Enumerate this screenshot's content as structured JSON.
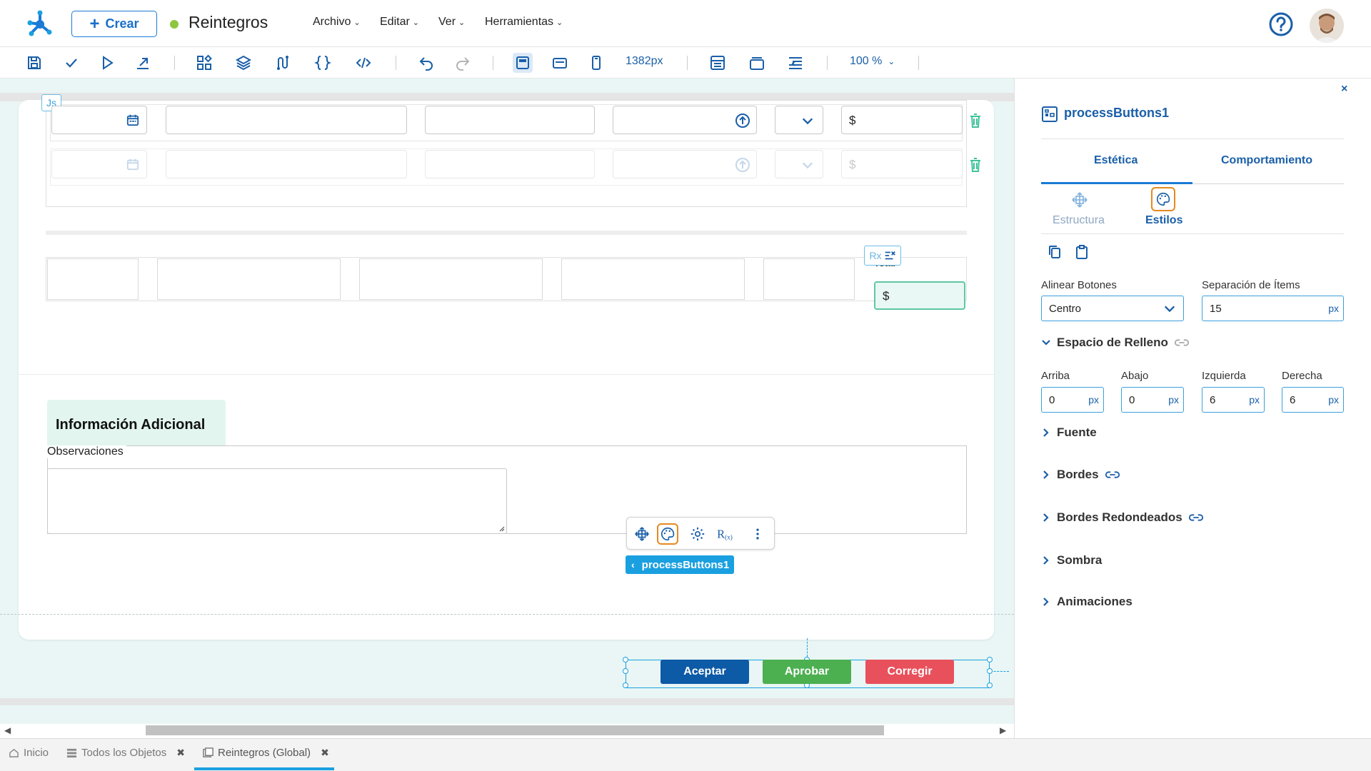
{
  "header": {
    "create_label": "Crear",
    "doc_title": "Reintegros",
    "menus": [
      "Archivo",
      "Editar",
      "Ver",
      "Herramientas"
    ]
  },
  "toolbar": {
    "width_label": "1382px",
    "zoom_label": "100 %"
  },
  "canvas": {
    "js_badge": "Js",
    "currency_symbol": "$",
    "total_label": "Total",
    "rx_badge": "Rx",
    "info_title": "Información Adicional",
    "obs_label": "Observaciones",
    "process_tag": "processButtons1",
    "buttons": {
      "accept": "Aceptar",
      "approve": "Aprobar",
      "correct": "Corregir"
    },
    "colors": {
      "accept": "#0d5aa6",
      "approve": "#4caf50",
      "correct": "#e8505b"
    }
  },
  "panel": {
    "close": "×",
    "title": "processButtons1",
    "tabs": [
      "Estética",
      "Comportamiento"
    ],
    "subtabs": [
      "Estructura",
      "Estilos"
    ],
    "align_label": "Alinear Botones",
    "align_value": "Centro",
    "sep_label": "Separación de Ítems",
    "sep_value": "15",
    "unit": "px",
    "padding_section": "Espacio de Relleno",
    "padding": [
      {
        "label": "Arriba",
        "value": "0"
      },
      {
        "label": "Abajo",
        "value": "0"
      },
      {
        "label": "Izquierda",
        "value": "6"
      },
      {
        "label": "Derecha",
        "value": "6"
      }
    ],
    "sections": [
      "Fuente",
      "Bordes",
      "Bordes Redondeados",
      "Sombra",
      "Animaciones"
    ]
  },
  "bottom_tabs": [
    {
      "label": "Inicio",
      "icon": "home-icon"
    },
    {
      "label": "Todos los Objetos",
      "icon": "list-icon"
    },
    {
      "label": "Reintegros (Global)",
      "icon": "form-icon"
    }
  ]
}
